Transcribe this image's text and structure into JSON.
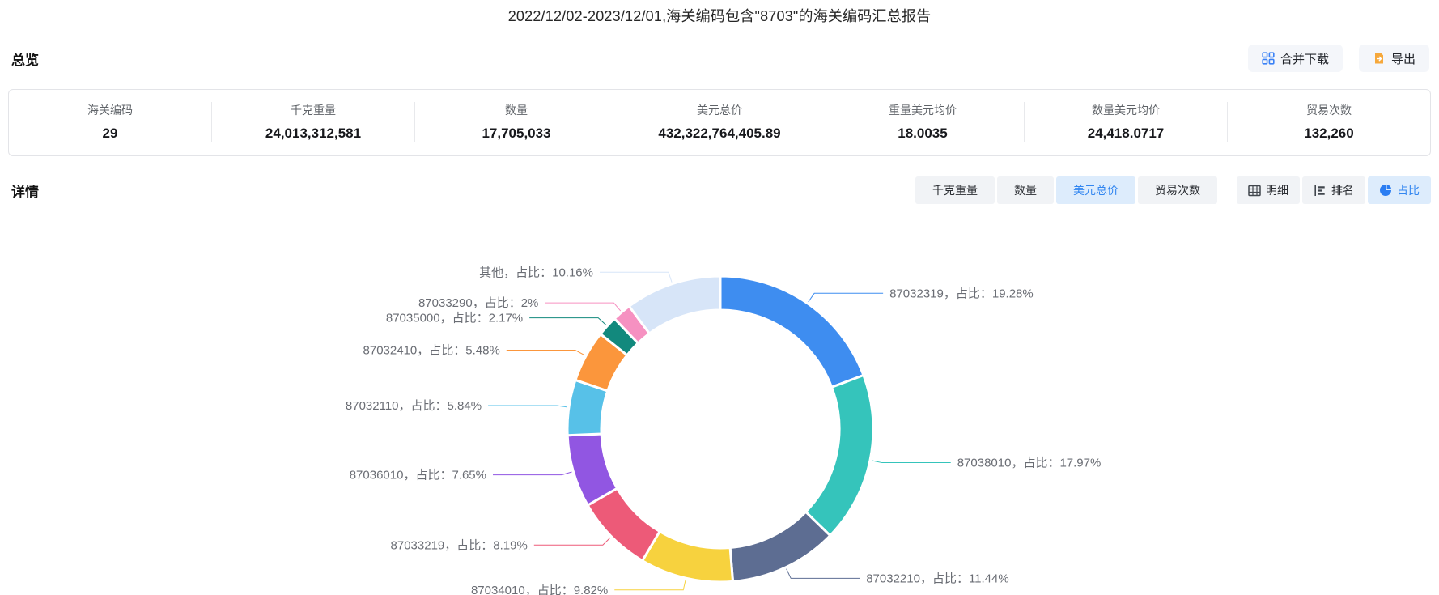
{
  "title": "2022/12/02-2023/12/01,海关编码包含\"8703\"的海关编码汇总报告",
  "overview": {
    "heading": "总览",
    "actions": [
      {
        "label": "合并下载",
        "icon": "merge-download-icon",
        "icon_color": "#3b82f6"
      },
      {
        "label": "导出",
        "icon": "export-icon",
        "icon_color": "#f6a83b"
      }
    ],
    "stats": [
      {
        "label": "海关编码",
        "value": "29"
      },
      {
        "label": "千克重量",
        "value": "24,013,312,581"
      },
      {
        "label": "数量",
        "value": "17,705,033"
      },
      {
        "label": "美元总价",
        "value": "432,322,764,405.89"
      },
      {
        "label": "重量美元均价",
        "value": "18.0035"
      },
      {
        "label": "数量美元均价",
        "value": "24,418.0717"
      },
      {
        "label": "贸易次数",
        "value": "132,260"
      }
    ]
  },
  "detail": {
    "heading": "详情",
    "metric_tabs": [
      {
        "label": "千克重量",
        "active": false
      },
      {
        "label": "数量",
        "active": false
      },
      {
        "label": "美元总价",
        "active": true
      },
      {
        "label": "贸易次数",
        "active": false
      }
    ],
    "view_tabs": [
      {
        "label": "明细",
        "icon": "table-icon",
        "active": false
      },
      {
        "label": "排名",
        "icon": "ranking-icon",
        "active": false
      },
      {
        "label": "占比",
        "icon": "pie-icon",
        "active": true
      }
    ]
  },
  "chart_data": {
    "type": "pie",
    "subtype": "donut",
    "title": "",
    "legend": "none",
    "label_template": "{name}，占比：{pct}%",
    "start_angle_deg": 0,
    "direction": "clockwise",
    "slices": [
      {
        "name": "87032319",
        "pct": "19.28",
        "color": "#3e8df0"
      },
      {
        "name": "87038010",
        "pct": "17.97",
        "color": "#35c4bb"
      },
      {
        "name": "87032210",
        "pct": "11.44",
        "color": "#5d6d92"
      },
      {
        "name": "87034010",
        "pct": "9.82",
        "color": "#f7d23e"
      },
      {
        "name": "87033219",
        "pct": "8.19",
        "color": "#ed5a78"
      },
      {
        "name": "87036010",
        "pct": "7.65",
        "color": "#9156e2"
      },
      {
        "name": "87032110",
        "pct": "5.84",
        "color": "#57c1e8"
      },
      {
        "name": "87032410",
        "pct": "5.48",
        "color": "#fb963c"
      },
      {
        "name": "87035000",
        "pct": "2.17",
        "color": "#12897d"
      },
      {
        "name": "87033290",
        "pct": "2",
        "color": "#f691c1"
      },
      {
        "name": "其他",
        "pct": "10.16",
        "color": "#d7e5f8"
      }
    ]
  }
}
